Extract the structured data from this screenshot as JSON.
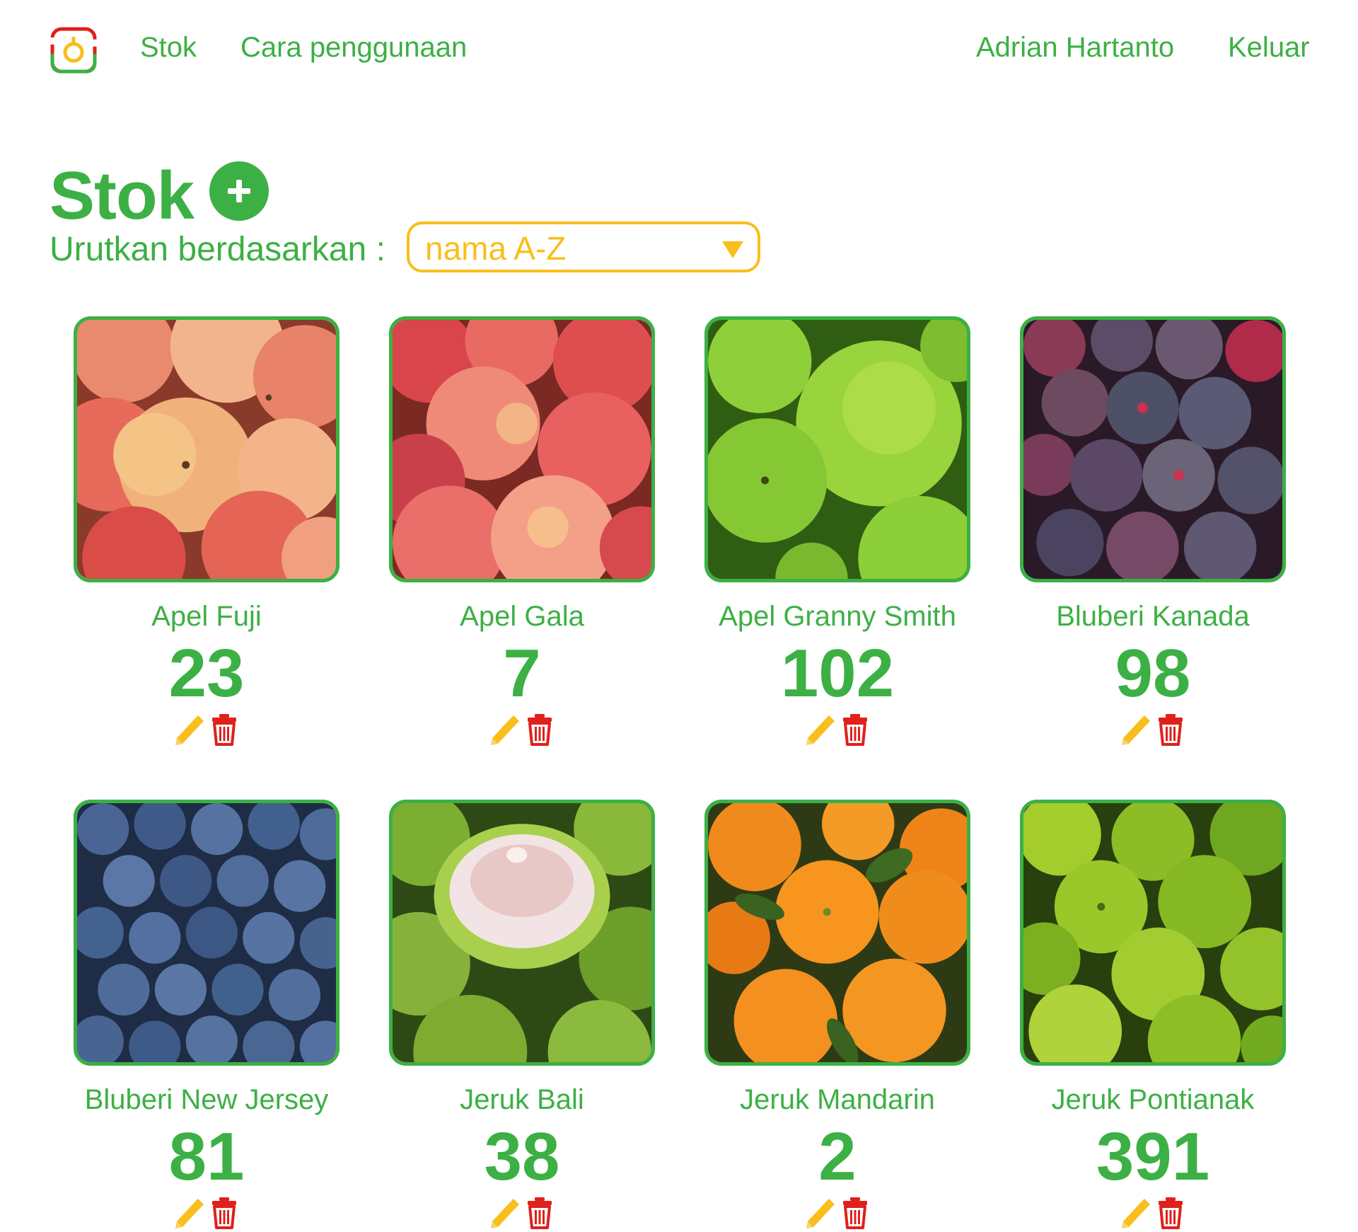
{
  "nav": {
    "logo_icon": "scale-logo-icon",
    "links": [
      "Stok",
      "Cara penggunaan"
    ],
    "user_name": "Adrian Hartanto",
    "logout_label": "Keluar"
  },
  "page": {
    "title": "Stok",
    "add_icon": "plus-circle-icon",
    "sort_label": "Urutkan berdasarkan :",
    "sort_value": "nama A-Z"
  },
  "items": [
    {
      "name": "Apel Fuji",
      "qty": "23",
      "photo": "fuji-apples-photo"
    },
    {
      "name": "Apel Gala",
      "qty": "7",
      "photo": "gala-apples-photo"
    },
    {
      "name": "Apel Granny Smith",
      "qty": "102",
      "photo": "granny-smith-apples-photo"
    },
    {
      "name": "Bluberi Kanada",
      "qty": "98",
      "photo": "canada-blueberries-photo"
    },
    {
      "name": "Bluberi New Jersey",
      "qty": "81",
      "photo": "new-jersey-blueberries-photo"
    },
    {
      "name": "Jeruk Bali",
      "qty": "38",
      "photo": "pomelo-photo"
    },
    {
      "name": "Jeruk Mandarin",
      "qty": "2",
      "photo": "mandarin-oranges-photo"
    },
    {
      "name": "Jeruk Pontianak",
      "qty": "391",
      "photo": "pontianak-oranges-photo"
    }
  ],
  "actions": {
    "edit_icon": "pencil-icon",
    "delete_icon": "trash-icon"
  },
  "colors": {
    "primary_green": "#3cb044",
    "accent_yellow": "#f9be1c",
    "delete_red": "#e0201b"
  }
}
